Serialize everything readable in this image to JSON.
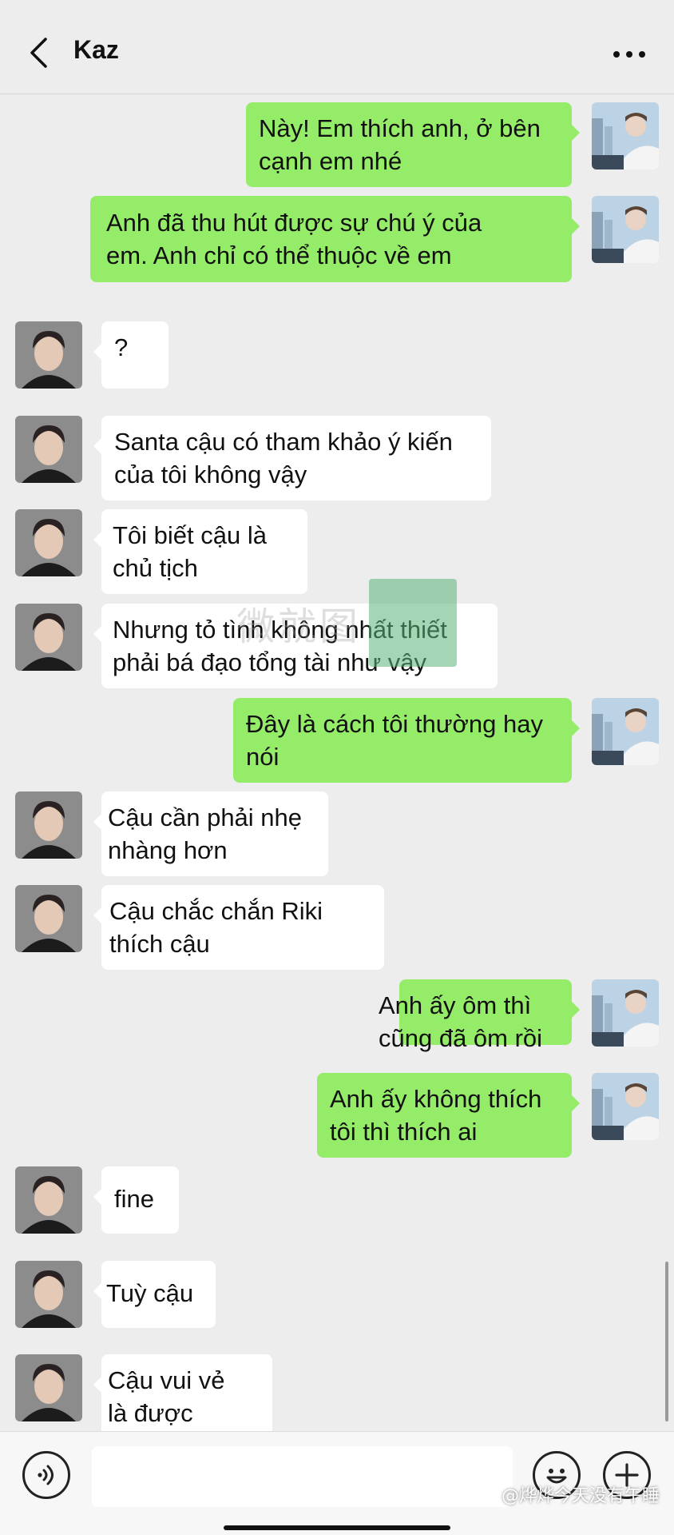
{
  "header": {
    "title": "Kaz"
  },
  "icons": {
    "back": "chevron-left-icon",
    "more": "more-dots-icon",
    "voice": "voice-icon",
    "emoji": "emoji-icon",
    "plus": "plus-icon"
  },
  "colors": {
    "background": "#ededed",
    "outgoing_bubble": "#95ec69",
    "incoming_bubble": "#ffffff"
  },
  "messages": [
    {
      "sender": "me",
      "text": "Này! Em thích anh, ở bên\ncạnh em nhé"
    },
    {
      "sender": "me",
      "text": "Anh đã thu hút được sự chú ý của\nem. Anh chỉ có thể thuộc về em"
    },
    {
      "sender": "them",
      "text": "?"
    },
    {
      "sender": "them",
      "text": "Santa cậu có tham khảo ý kiến\ncủa tôi không vậy"
    },
    {
      "sender": "them",
      "text": "Tôi biết cậu là\nchủ tịch"
    },
    {
      "sender": "them",
      "text": "Nhưng tỏ tình không nhất thiết\nphải bá đạo tổng tài như vậy"
    },
    {
      "sender": "me",
      "text": "Đây là cách tôi thường hay\nnói"
    },
    {
      "sender": "them",
      "text": "Cậu cần phải nhẹ\nnhàng hơn"
    },
    {
      "sender": "them",
      "text": "Cậu chắc chắn Riki\nthích cậu"
    },
    {
      "sender": "me",
      "text": "Anh ấy ôm thì\ncũng đã ôm rồi"
    },
    {
      "sender": "me",
      "text": "Anh ấy không thích\ntôi thì thích ai"
    },
    {
      "sender": "them",
      "text": "fine"
    },
    {
      "sender": "them",
      "text": "Tuỳ cậu"
    },
    {
      "sender": "them",
      "text": "Cậu vui vẻ\nlà được"
    }
  ],
  "watermark": {
    "text": "微就图"
  },
  "input": {
    "value": "",
    "placeholder": ""
  },
  "credit": "@烨烨今天没有午睡"
}
